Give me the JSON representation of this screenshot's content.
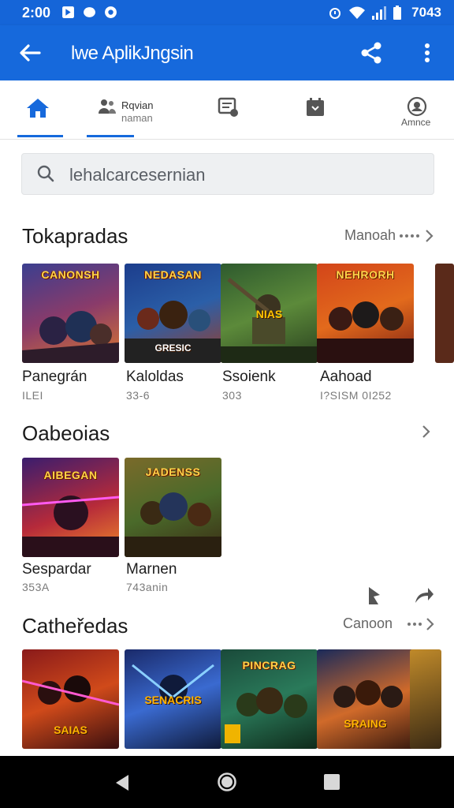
{
  "status": {
    "time": "2:00",
    "clock_right": "7043"
  },
  "appbar": {
    "title": "lwe AplikJngsin"
  },
  "tabs": [
    {
      "label": "",
      "icon": "home-icon"
    },
    {
      "label": "Rqvian",
      "sublabel": "naman",
      "icon": "people-icon"
    },
    {
      "label": "",
      "icon": "note-icon"
    },
    {
      "label": "",
      "icon": "calendar-icon"
    },
    {
      "label": "Amnce",
      "icon": "settings-circle-icon"
    }
  ],
  "search": {
    "placeholder": "lehalcarcesernian"
  },
  "sections": [
    {
      "title": "Tokapradas",
      "more": "Manoah",
      "items": [
        {
          "name": "Panegrán",
          "sub": "ILEI",
          "art_top": "CANONSH",
          "art_bottom": ""
        },
        {
          "name": "Kaloldas",
          "sub": "33-6",
          "art_top": "NEDASAN",
          "art_bottom": "GRESIC"
        },
        {
          "name": "Ssoienk",
          "sub": "303",
          "art_top": "",
          "art_bottom": "NIAS"
        },
        {
          "name": "Aahoad",
          "sub": "I?SISM 0I252",
          "art_top": "NEHRORH",
          "art_bottom": ""
        }
      ]
    },
    {
      "title": "Oabeoias",
      "more": "",
      "items": [
        {
          "name": "Sespardar",
          "sub": "353A",
          "art_top": "AIBEGAN",
          "art_bottom": ""
        },
        {
          "name": "Marnen",
          "sub": "743anin",
          "art_top": "JADENSS",
          "art_bottom": ""
        }
      ]
    },
    {
      "title": "Catheředas",
      "more": "Canoon",
      "items": [
        {
          "name": "",
          "sub": "",
          "art_top": "",
          "art_bottom": "SAIAS"
        },
        {
          "name": "",
          "sub": "",
          "art_top": "",
          "art_bottom": "SENACRIS"
        },
        {
          "name": "",
          "sub": "",
          "art_top": "PINCRAG",
          "art_bottom": ""
        },
        {
          "name": "",
          "sub": "",
          "art_top": "",
          "art_bottom": "SRAING"
        }
      ]
    }
  ],
  "colors": {
    "primary": "#1669dc",
    "statusbar": "#1565d8",
    "navbar": "#000000"
  }
}
